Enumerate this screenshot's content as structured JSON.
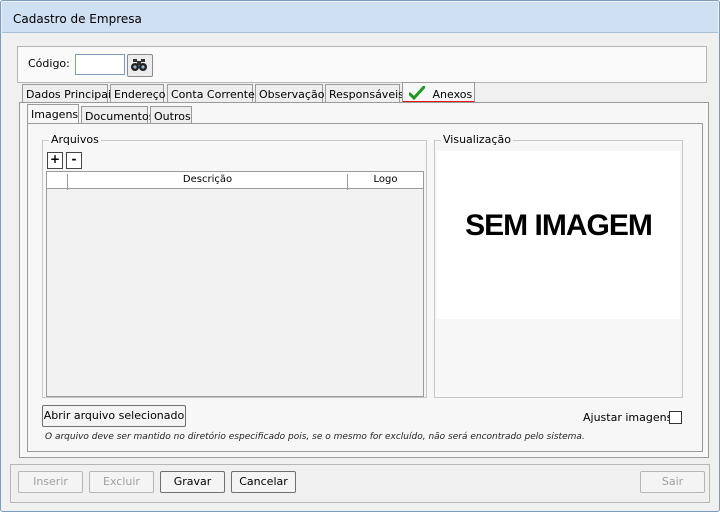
{
  "window": {
    "title": "Cadastro de Empresa"
  },
  "codigo": {
    "label": "Código:",
    "value": "",
    "search_icon": "binoculars-icon"
  },
  "tabs": [
    {
      "label": "Dados Principais"
    },
    {
      "label": "Endereço"
    },
    {
      "label": "Conta Corrente"
    },
    {
      "label": "Observação"
    },
    {
      "label": "Responsáveis"
    },
    {
      "label": "Anexos",
      "icon": "checkmark-icon",
      "active": true
    }
  ],
  "subtabs": [
    {
      "label": "Imagens",
      "active": true
    },
    {
      "label": "Documentos"
    },
    {
      "label": "Outros"
    }
  ],
  "arquivos": {
    "legend": "Arquivos",
    "add_label": "+",
    "remove_label": "-",
    "columns": [
      "",
      "Descrição",
      "Logo"
    ],
    "rows": []
  },
  "visualizacao": {
    "legend": "Visualização",
    "placeholder": "SEM IMAGEM"
  },
  "open_button": "Abrir arquivo selecionado",
  "ajustar": {
    "label": "Ajustar imagens",
    "checked": false
  },
  "note": "O arquivo deve ser mantido no diretório especificado pois, se o mesmo for excluído, não será encontrado pelo sistema.",
  "actions": {
    "inserir": "Inserir",
    "excluir": "Excluir",
    "gravar": "Gravar",
    "cancelar": "Cancelar",
    "sair": "Sair"
  },
  "colors": {
    "titlebar": "#cfe0f3",
    "check_green": "#1e9a1e",
    "active_tab_underline": "#e8141c"
  }
}
